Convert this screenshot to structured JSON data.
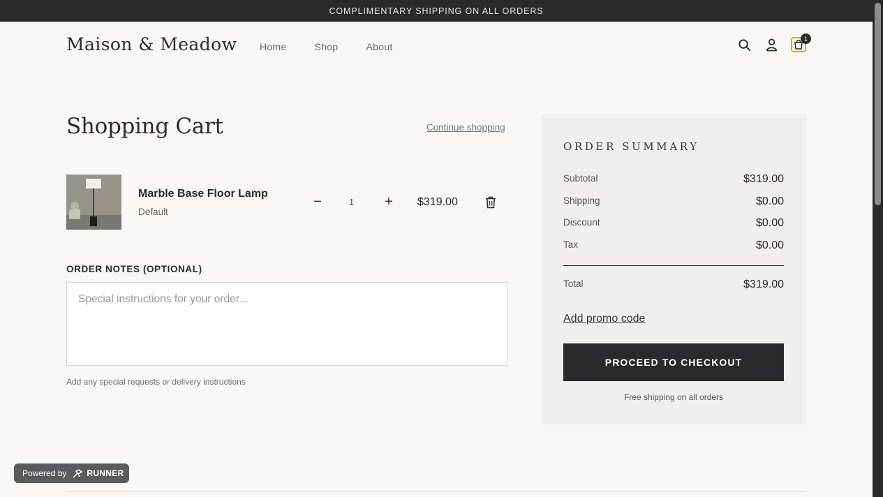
{
  "announcement": "COMPLIMENTARY SHIPPING ON ALL ORDERS",
  "header": {
    "logo": "Maison & Meadow",
    "nav": [
      "Home",
      "Shop",
      "About"
    ],
    "icons": [
      "search-icon",
      "account-icon",
      "bag-icon"
    ],
    "cart_count": "1"
  },
  "cart": {
    "title": "Shopping Cart",
    "continue_label": "Continue shopping",
    "items": [
      {
        "name": "Marble Base Floor Lamp",
        "variant": "Default",
        "quantity": "1",
        "price": "$319.00",
        "decrease_symbol": "−",
        "increase_symbol": "+"
      }
    ]
  },
  "notes": {
    "label": "ORDER NOTES (OPTIONAL)",
    "placeholder": "Special instructions for your order...",
    "help": "Add any special requests or delivery instructions"
  },
  "summary": {
    "title": "ORDER SUMMARY",
    "rows": [
      {
        "label": "Subtotal",
        "value": "$319.00"
      },
      {
        "label": "Shipping",
        "value": "$0.00"
      },
      {
        "label": "Discount",
        "value": "$0.00"
      },
      {
        "label": "Tax",
        "value": "$0.00"
      }
    ],
    "total_label": "Total",
    "total_value": "$319.00",
    "promo_label": "Add promo code",
    "checkout_label": "PROCEED TO CHECKOUT",
    "free_note": "Free shipping on all orders"
  },
  "badge": {
    "powered_by": "Powered by",
    "brand": "RUNNER"
  },
  "colors": {
    "announcement_bg": "#2c2a27",
    "checkout_bg": "#2a2a2c",
    "summary_bg": "#f1efeb",
    "bag_accent": "#d9a236"
  }
}
